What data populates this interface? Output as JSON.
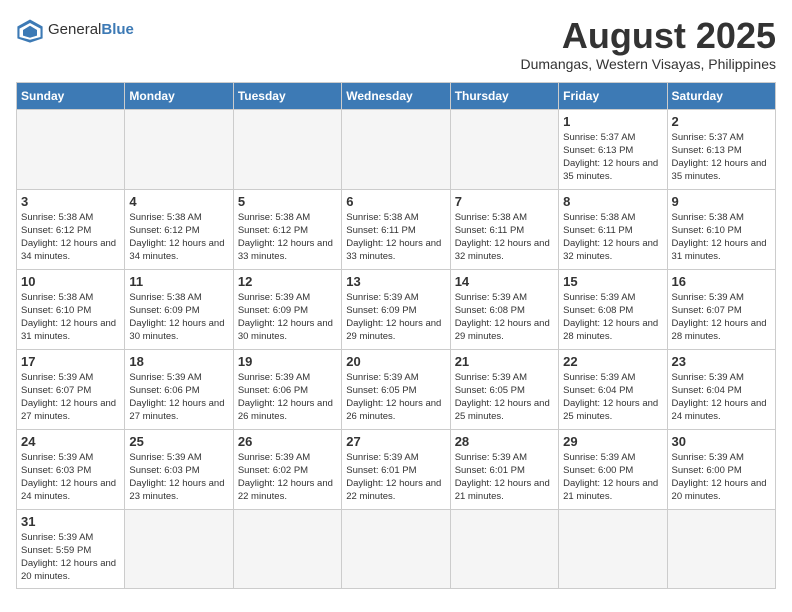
{
  "header": {
    "logo_general": "General",
    "logo_blue": "Blue",
    "title": "August 2025",
    "subtitle": "Dumangas, Western Visayas, Philippines"
  },
  "weekdays": [
    "Sunday",
    "Monday",
    "Tuesday",
    "Wednesday",
    "Thursday",
    "Friday",
    "Saturday"
  ],
  "weeks": [
    [
      {
        "day": "",
        "info": ""
      },
      {
        "day": "",
        "info": ""
      },
      {
        "day": "",
        "info": ""
      },
      {
        "day": "",
        "info": ""
      },
      {
        "day": "",
        "info": ""
      },
      {
        "day": "1",
        "info": "Sunrise: 5:37 AM\nSunset: 6:13 PM\nDaylight: 12 hours\nand 35 minutes."
      },
      {
        "day": "2",
        "info": "Sunrise: 5:37 AM\nSunset: 6:13 PM\nDaylight: 12 hours\nand 35 minutes."
      }
    ],
    [
      {
        "day": "3",
        "info": "Sunrise: 5:38 AM\nSunset: 6:12 PM\nDaylight: 12 hours\nand 34 minutes."
      },
      {
        "day": "4",
        "info": "Sunrise: 5:38 AM\nSunset: 6:12 PM\nDaylight: 12 hours\nand 34 minutes."
      },
      {
        "day": "5",
        "info": "Sunrise: 5:38 AM\nSunset: 6:12 PM\nDaylight: 12 hours\nand 33 minutes."
      },
      {
        "day": "6",
        "info": "Sunrise: 5:38 AM\nSunset: 6:11 PM\nDaylight: 12 hours\nand 33 minutes."
      },
      {
        "day": "7",
        "info": "Sunrise: 5:38 AM\nSunset: 6:11 PM\nDaylight: 12 hours\nand 32 minutes."
      },
      {
        "day": "8",
        "info": "Sunrise: 5:38 AM\nSunset: 6:11 PM\nDaylight: 12 hours\nand 32 minutes."
      },
      {
        "day": "9",
        "info": "Sunrise: 5:38 AM\nSunset: 6:10 PM\nDaylight: 12 hours\nand 31 minutes."
      }
    ],
    [
      {
        "day": "10",
        "info": "Sunrise: 5:38 AM\nSunset: 6:10 PM\nDaylight: 12 hours\nand 31 minutes."
      },
      {
        "day": "11",
        "info": "Sunrise: 5:38 AM\nSunset: 6:09 PM\nDaylight: 12 hours\nand 30 minutes."
      },
      {
        "day": "12",
        "info": "Sunrise: 5:39 AM\nSunset: 6:09 PM\nDaylight: 12 hours\nand 30 minutes."
      },
      {
        "day": "13",
        "info": "Sunrise: 5:39 AM\nSunset: 6:09 PM\nDaylight: 12 hours\nand 29 minutes."
      },
      {
        "day": "14",
        "info": "Sunrise: 5:39 AM\nSunset: 6:08 PM\nDaylight: 12 hours\nand 29 minutes."
      },
      {
        "day": "15",
        "info": "Sunrise: 5:39 AM\nSunset: 6:08 PM\nDaylight: 12 hours\nand 28 minutes."
      },
      {
        "day": "16",
        "info": "Sunrise: 5:39 AM\nSunset: 6:07 PM\nDaylight: 12 hours\nand 28 minutes."
      }
    ],
    [
      {
        "day": "17",
        "info": "Sunrise: 5:39 AM\nSunset: 6:07 PM\nDaylight: 12 hours\nand 27 minutes."
      },
      {
        "day": "18",
        "info": "Sunrise: 5:39 AM\nSunset: 6:06 PM\nDaylight: 12 hours\nand 27 minutes."
      },
      {
        "day": "19",
        "info": "Sunrise: 5:39 AM\nSunset: 6:06 PM\nDaylight: 12 hours\nand 26 minutes."
      },
      {
        "day": "20",
        "info": "Sunrise: 5:39 AM\nSunset: 6:05 PM\nDaylight: 12 hours\nand 26 minutes."
      },
      {
        "day": "21",
        "info": "Sunrise: 5:39 AM\nSunset: 6:05 PM\nDaylight: 12 hours\nand 25 minutes."
      },
      {
        "day": "22",
        "info": "Sunrise: 5:39 AM\nSunset: 6:04 PM\nDaylight: 12 hours\nand 25 minutes."
      },
      {
        "day": "23",
        "info": "Sunrise: 5:39 AM\nSunset: 6:04 PM\nDaylight: 12 hours\nand 24 minutes."
      }
    ],
    [
      {
        "day": "24",
        "info": "Sunrise: 5:39 AM\nSunset: 6:03 PM\nDaylight: 12 hours\nand 24 minutes."
      },
      {
        "day": "25",
        "info": "Sunrise: 5:39 AM\nSunset: 6:03 PM\nDaylight: 12 hours\nand 23 minutes."
      },
      {
        "day": "26",
        "info": "Sunrise: 5:39 AM\nSunset: 6:02 PM\nDaylight: 12 hours\nand 22 minutes."
      },
      {
        "day": "27",
        "info": "Sunrise: 5:39 AM\nSunset: 6:01 PM\nDaylight: 12 hours\nand 22 minutes."
      },
      {
        "day": "28",
        "info": "Sunrise: 5:39 AM\nSunset: 6:01 PM\nDaylight: 12 hours\nand 21 minutes."
      },
      {
        "day": "29",
        "info": "Sunrise: 5:39 AM\nSunset: 6:00 PM\nDaylight: 12 hours\nand 21 minutes."
      },
      {
        "day": "30",
        "info": "Sunrise: 5:39 AM\nSunset: 6:00 PM\nDaylight: 12 hours\nand 20 minutes."
      }
    ],
    [
      {
        "day": "31",
        "info": "Sunrise: 5:39 AM\nSunset: 5:59 PM\nDaylight: 12 hours\nand 20 minutes."
      },
      {
        "day": "",
        "info": ""
      },
      {
        "day": "",
        "info": ""
      },
      {
        "day": "",
        "info": ""
      },
      {
        "day": "",
        "info": ""
      },
      {
        "day": "",
        "info": ""
      },
      {
        "day": "",
        "info": ""
      }
    ]
  ]
}
